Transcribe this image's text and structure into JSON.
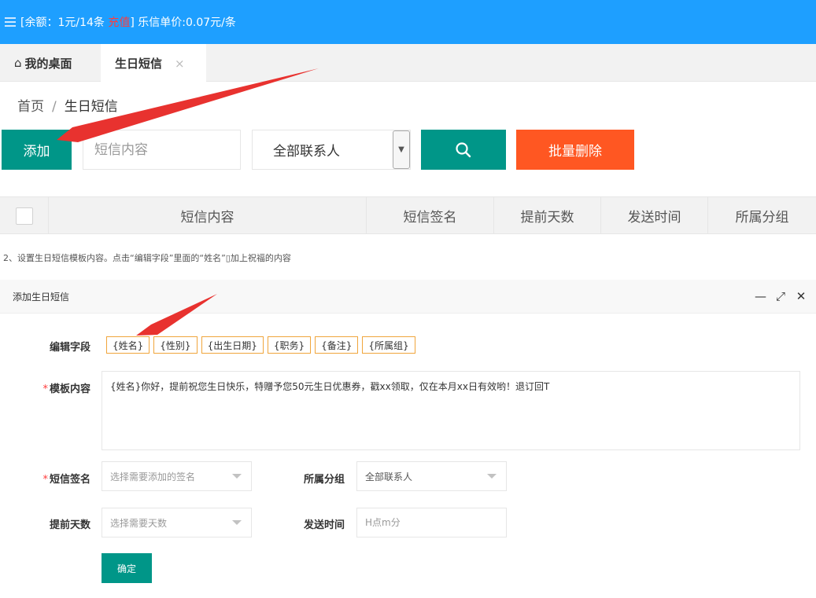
{
  "topbar": {
    "menu_icon": "hamburger-icon",
    "balance_prefix": "[余额：1元/14条 ",
    "recharge_label": "充值",
    "balance_suffix": "] 乐信单价:0.07元/条"
  },
  "tabs": {
    "home_icon": "home-icon",
    "home_label": "我的桌面",
    "active_label": "生日短信",
    "close_glyph": "×"
  },
  "breadcrumb": {
    "home": "首页",
    "separator": "/",
    "current": "生日短信"
  },
  "toolbar": {
    "add_label": "添加",
    "search_placeholder": "短信内容",
    "contact_select_value": "全部联系人",
    "search_icon": "search-icon",
    "batch_delete_label": "批量删除"
  },
  "table": {
    "columns": [
      "短信内容",
      "短信签名",
      "提前天数",
      "发送时间",
      "所属分组"
    ]
  },
  "instruction": "2、设置生日短信模板内容。点击“编辑字段”里面的“姓名”▯加上祝福的内容",
  "dialog": {
    "title": "添加生日短信",
    "minimize_glyph": "—",
    "maximize_glyph": "⤢",
    "close_glyph": "✕",
    "field_label": "编辑字段",
    "tags": [
      "{姓名}",
      "{性别}",
      "{出生日期}",
      "{职务}",
      "{备注}",
      "{所属组}"
    ],
    "template_label": "模板内容",
    "template_value": "{姓名}你好，提前祝您生日快乐，特赠予您50元生日优惠券，戳xx领取，仅在本月xx日有效哟！退订回T",
    "required_mark": "*",
    "sign_label": "短信签名",
    "sign_placeholder": "选择需要添加的签名",
    "group_label": "所属分组",
    "group_value": "全部联系人",
    "days_label": "提前天数",
    "days_placeholder": "选择需要天数",
    "time_label": "发送时间",
    "time_placeholder": "H点m分",
    "confirm_label": "确定"
  },
  "colors": {
    "topbar": "#1e9fff",
    "primary": "#009688",
    "danger": "#ff5722",
    "annotation_arrow": "#e8322f"
  }
}
